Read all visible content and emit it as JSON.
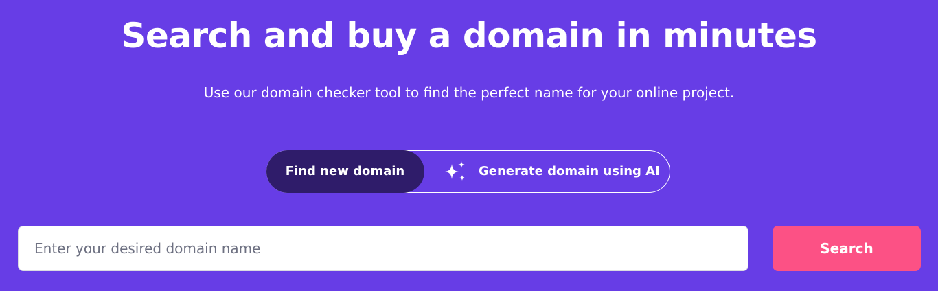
{
  "hero": {
    "title": "Search and buy a domain in minutes",
    "subtitle": "Use our domain checker tool to find the perfect name for your online project."
  },
  "tabs": {
    "find_label": "Find new domain",
    "ai_label": "Generate domain using AI",
    "ai_icon": "sparkle-icon",
    "active": "find"
  },
  "search": {
    "placeholder": "Enter your desired domain name",
    "value": "",
    "button_label": "Search"
  },
  "colors": {
    "background": "#673DE6",
    "active_tab": "#2F1C6A",
    "search_button": "#FC5185",
    "text": "#FFFFFF"
  }
}
